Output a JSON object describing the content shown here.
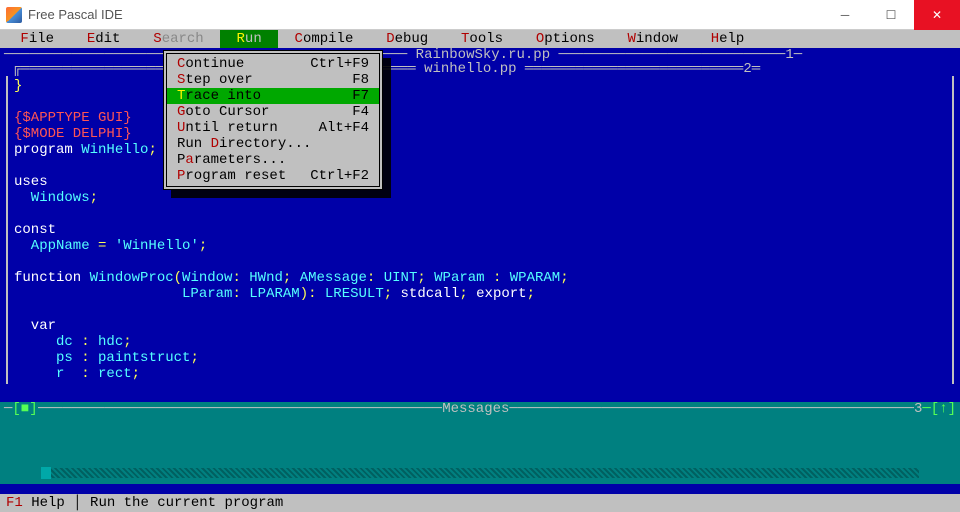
{
  "window": {
    "title": "Free Pascal IDE"
  },
  "menubar": [
    {
      "hotkey": "F",
      "label": "ile"
    },
    {
      "hotkey": "E",
      "label": "dit"
    },
    {
      "hotkey": "S",
      "label": "earch",
      "disabled": true
    },
    {
      "hotkey": "R",
      "label": "un",
      "active": true
    },
    {
      "hotkey": "C",
      "label": "ompile"
    },
    {
      "hotkey": "D",
      "label": "ebug"
    },
    {
      "hotkey": "T",
      "label": "ools"
    },
    {
      "hotkey": "O",
      "label": "ptions"
    },
    {
      "hotkey": "W",
      "label": "indow"
    },
    {
      "hotkey": "H",
      "label": "elp"
    }
  ],
  "dropdown": {
    "items": [
      {
        "hk": "C",
        "label": "ontinue",
        "shortcut": "Ctrl+F9"
      },
      {
        "hk": "S",
        "label": "tep over",
        "shortcut": "F8"
      },
      {
        "hk": "T",
        "label": "race into",
        "shortcut": "F7",
        "selected": true
      },
      {
        "hk": "G",
        "label": "oto Cursor",
        "shortcut": "F4"
      },
      {
        "hk": "U",
        "label": "ntil return",
        "shortcut": "Alt+F4"
      },
      {
        "hk": "D",
        "plabel": "Run ",
        "label": "irectory...",
        "shortcut": ""
      },
      {
        "hk": "a",
        "plabel": "P",
        "label": "rameters...",
        "shortcut": ""
      },
      {
        "hk": "P",
        "label": "rogram reset",
        "shortcut": "Ctrl+F2"
      }
    ]
  },
  "tabs": {
    "background_file": "RainbowSky.ru.pp",
    "background_num": "1",
    "active_file": "winhello.pp",
    "active_num": "2"
  },
  "code": [
    {
      "cls": "tok-cb",
      "text": "}"
    },
    {
      "cls": "",
      "text": ""
    },
    {
      "cls": "tok-red",
      "text": "{$APPTYPE GUI}"
    },
    {
      "cls": "tok-red",
      "text": "{$MODE DELPHI}"
    },
    {
      "cls": "mixed",
      "segments": [
        [
          "tok-white",
          "program "
        ],
        [
          "tok-cyan",
          "WinHello"
        ],
        [
          "tok-cb",
          ";"
        ]
      ]
    },
    {
      "cls": "",
      "text": ""
    },
    {
      "cls": "tok-white",
      "text": "uses"
    },
    {
      "cls": "mixed",
      "segments": [
        [
          "tok-cyan",
          "  Windows"
        ],
        [
          "tok-cb",
          ";"
        ]
      ]
    },
    {
      "cls": "",
      "text": ""
    },
    {
      "cls": "tok-white",
      "text": "const"
    },
    {
      "cls": "mixed",
      "segments": [
        [
          "tok-cyan",
          "  AppName "
        ],
        [
          "tok-cb",
          "= "
        ],
        [
          "tok-cyan",
          "'WinHello'"
        ],
        [
          "tok-cb",
          ";"
        ]
      ]
    },
    {
      "cls": "",
      "text": ""
    },
    {
      "cls": "mixed",
      "segments": [
        [
          "tok-white",
          "function "
        ],
        [
          "tok-cyan",
          "WindowProc"
        ],
        [
          "tok-cb",
          "("
        ],
        [
          "tok-cyan",
          "Window"
        ],
        [
          "tok-cb",
          ": "
        ],
        [
          "tok-cyan",
          "HWnd"
        ],
        [
          "tok-cb",
          "; "
        ],
        [
          "tok-cyan",
          "AMessage"
        ],
        [
          "tok-cb",
          ": "
        ],
        [
          "tok-cyan",
          "UINT"
        ],
        [
          "tok-cb",
          "; "
        ],
        [
          "tok-cyan",
          "WParam "
        ],
        [
          "tok-cb",
          ": "
        ],
        [
          "tok-cyan",
          "WPARAM"
        ],
        [
          "tok-cb",
          ";"
        ]
      ]
    },
    {
      "cls": "mixed",
      "segments": [
        [
          "",
          "                    "
        ],
        [
          "tok-cyan",
          "LParam"
        ],
        [
          "tok-cb",
          ": "
        ],
        [
          "tok-cyan",
          "LPARAM"
        ],
        [
          "tok-cb",
          "): "
        ],
        [
          "tok-cyan",
          "LRESULT"
        ],
        [
          "tok-cb",
          "; "
        ],
        [
          "tok-white",
          "stdcall"
        ],
        [
          "tok-cb",
          "; "
        ],
        [
          "tok-white",
          "export"
        ],
        [
          "tok-cb",
          ";"
        ]
      ]
    },
    {
      "cls": "",
      "text": ""
    },
    {
      "cls": "tok-white",
      "text": "  var"
    },
    {
      "cls": "mixed",
      "segments": [
        [
          "tok-cyan",
          "     dc "
        ],
        [
          "tok-cb",
          ": "
        ],
        [
          "tok-cyan",
          "hdc"
        ],
        [
          "tok-cb",
          ";"
        ]
      ]
    },
    {
      "cls": "mixed",
      "segments": [
        [
          "tok-cyan",
          "     ps "
        ],
        [
          "tok-cb",
          ": "
        ],
        [
          "tok-cyan",
          "paintstruct"
        ],
        [
          "tok-cb",
          ";"
        ]
      ]
    },
    {
      "cls": "mixed",
      "segments": [
        [
          "tok-cyan",
          "     r  "
        ],
        [
          "tok-cb",
          ": "
        ],
        [
          "tok-cyan",
          "rect"
        ],
        [
          "tok-cb",
          ";"
        ]
      ]
    }
  ],
  "messages": {
    "title": "Messages",
    "num": "3"
  },
  "statusbar": {
    "f1": "F1",
    "help": " Help ",
    "sep": "│ ",
    "hint": "Run the current program"
  }
}
